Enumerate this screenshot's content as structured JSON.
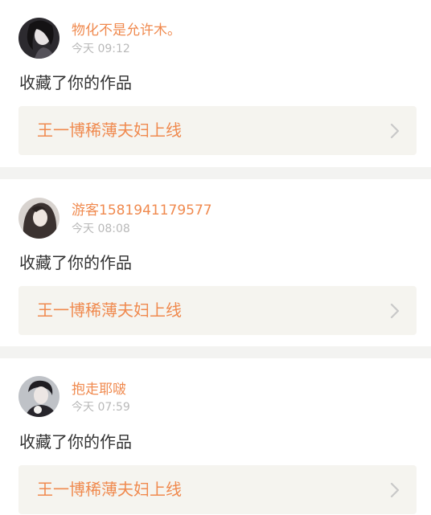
{
  "feed": {
    "items": [
      {
        "username": "物化不是允许木。",
        "time": "今天 09:12",
        "action": "收藏了你的作品",
        "work_title": "王一博稀薄夫妇上线"
      },
      {
        "username": "游客1581941179577",
        "time": "今天 08:08",
        "action": "收藏了你的作品",
        "work_title": "王一博稀薄夫妇上线"
      },
      {
        "username": "抱走耶啵",
        "time": "今天 07:59",
        "action": "收藏了你的作品",
        "work_title": "王一博稀薄夫妇上线"
      }
    ]
  },
  "colors": {
    "accent": "#f08a4f",
    "time": "#b9b9b9",
    "text": "#333333",
    "work_bg": "#f5f4ef",
    "divider": "#f3f3f1",
    "chevron": "#c8c8c8"
  }
}
